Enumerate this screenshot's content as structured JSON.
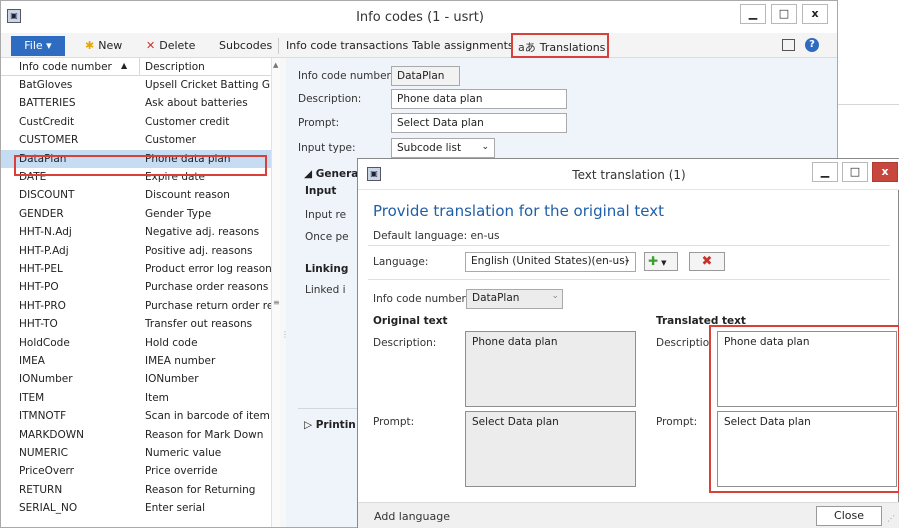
{
  "window": {
    "title": "Info codes (1 - usrt)",
    "minimize": "▁",
    "maximize": "□",
    "close": "x"
  },
  "ribbon": {
    "file": "File ▾",
    "new": "New",
    "delete": "Delete",
    "subcodes": "Subcodes",
    "info_code_transactions": "Info code transactions",
    "table_assignments": "Table assignments",
    "translations": "Translations"
  },
  "grid": {
    "columns": [
      "Info code number",
      "Description"
    ],
    "rows": [
      {
        "code": "BatGloves",
        "desc": "Upsell Cricket Batting Glov"
      },
      {
        "code": "BATTERIES",
        "desc": "Ask about batteries"
      },
      {
        "code": "CustCredit",
        "desc": "Customer credit"
      },
      {
        "code": "CUSTOMER",
        "desc": "Customer"
      },
      {
        "code": "DataPlan",
        "desc": "Phone data plan"
      },
      {
        "code": "DATE",
        "desc": "Expire date"
      },
      {
        "code": "DISCOUNT",
        "desc": "Discount reason"
      },
      {
        "code": "GENDER",
        "desc": "Gender Type"
      },
      {
        "code": "HHT-N.Adj",
        "desc": "Negative adj. reasons"
      },
      {
        "code": "HHT-P.Adj",
        "desc": "Positive adj. reasons"
      },
      {
        "code": "HHT-PEL",
        "desc": "Product error log reasons"
      },
      {
        "code": "HHT-PO",
        "desc": "Purchase order reasons"
      },
      {
        "code": "HHT-PRO",
        "desc": "Purchase return order reas"
      },
      {
        "code": "HHT-TO",
        "desc": "Transfer out reasons"
      },
      {
        "code": "HoldCode",
        "desc": "Hold code"
      },
      {
        "code": "IMEA",
        "desc": "IMEA number"
      },
      {
        "code": "IONumber",
        "desc": "IONumber"
      },
      {
        "code": "ITEM",
        "desc": "Item"
      },
      {
        "code": "ITMNOTF",
        "desc": "Scan in barcode of item no"
      },
      {
        "code": "MARKDOWN",
        "desc": "Reason for Mark Down"
      },
      {
        "code": "NUMERIC",
        "desc": "Numeric value"
      },
      {
        "code": "PriceOverr",
        "desc": "Price override"
      },
      {
        "code": "RETURN",
        "desc": "Reason for Returning"
      },
      {
        "code": "SERIAL_NO",
        "desc": "Enter serial"
      }
    ]
  },
  "detail": {
    "info_code_label": "Info code number:",
    "info_code_value": "DataPlan",
    "description_label": "Description:",
    "description_value": "Phone data plan",
    "prompt_label": "Prompt:",
    "prompt_value": "Select Data plan",
    "input_type_label": "Input type:",
    "input_type_value": "Subcode list",
    "general_section": "◢ Genera",
    "input_group": "Input",
    "input_req": "Input re",
    "once_per": "Once pe",
    "linking_group": "Linking",
    "linked_info": "Linked i",
    "printing_section": "▷ Printin"
  },
  "dialog": {
    "title": "Text translation (1)",
    "heading": "Provide translation for the original text",
    "default_language": "Default language: en-us",
    "language_label": "Language:",
    "language_value": "English (United States)(en-us)",
    "info_code_label": "Info code number:",
    "info_code_value": "DataPlan",
    "original_text": "Original text",
    "translated_text": "Translated text",
    "description_label": "Description:",
    "prompt_label": "Prompt:",
    "orig_description": "Phone data plan",
    "orig_prompt": "Select Data plan",
    "trans_description_label": "Descriptio",
    "trans_prompt_label": "Prompt:",
    "trans_description": "Phone data plan",
    "trans_prompt": "Select Data plan",
    "add_language": "Add language",
    "close": "Close",
    "minimize": "▁",
    "maximize": "□",
    "close_x": "x"
  },
  "colors": {
    "accent": "#2d6cc0",
    "highlight": "#d9403a",
    "selection": "#c6dcf3"
  }
}
